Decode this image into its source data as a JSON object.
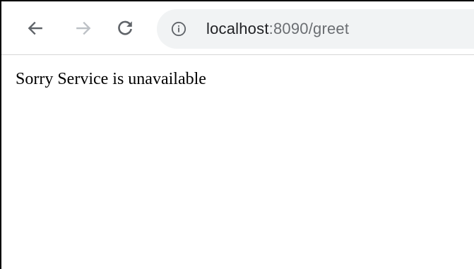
{
  "toolbar": {
    "back_icon": "arrow-left-icon",
    "forward_icon": "arrow-right-icon",
    "reload_icon": "reload-icon",
    "colors": {
      "icon_active": "#5f6368",
      "icon_disabled": "#bdc1c6",
      "omnibox_bg": "#f1f3f4"
    }
  },
  "address_bar": {
    "info_icon": "info-icon",
    "host": "localhost",
    "rest": ":8090/greet"
  },
  "page": {
    "message": "Sorry Service is unavailable"
  }
}
